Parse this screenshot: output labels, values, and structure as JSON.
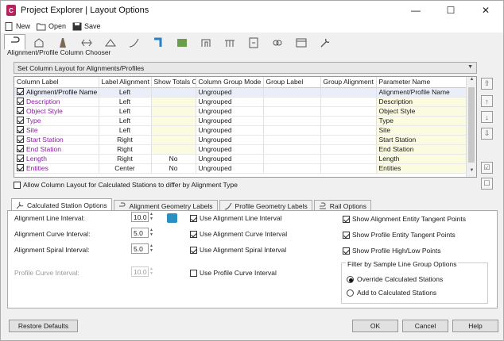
{
  "window": {
    "title": "Project Explorer | Layout Options"
  },
  "menu": {
    "new": "New",
    "open": "Open",
    "save": "Save"
  },
  "chooser": {
    "section_label": "Alignment/Profile Column Chooser",
    "layout_combo": "Set Column Layout for Alignments/Profiles",
    "columns": [
      "Column Label",
      "Label Alignment",
      "Show Totals Cell",
      "Column Group Mode",
      "Group Label",
      "Group Alignment",
      "Parameter Name"
    ],
    "rows": [
      {
        "label": "Alignment/Profile Name",
        "align": "Left",
        "totals": "",
        "mode": "Ungrouped",
        "group_label": "",
        "group_align": "",
        "param": "Alignment/Profile Name"
      },
      {
        "label": "Description",
        "align": "Left",
        "totals": "",
        "mode": "Ungrouped",
        "group_label": "",
        "group_align": "",
        "param": "Description"
      },
      {
        "label": "Object Style",
        "align": "Left",
        "totals": "",
        "mode": "Ungrouped",
        "group_label": "",
        "group_align": "",
        "param": "Object Style"
      },
      {
        "label": "Type",
        "align": "Left",
        "totals": "",
        "mode": "Ungrouped",
        "group_label": "",
        "group_align": "",
        "param": "Type"
      },
      {
        "label": "Site",
        "align": "Left",
        "totals": "",
        "mode": "Ungrouped",
        "group_label": "",
        "group_align": "",
        "param": "Site"
      },
      {
        "label": "Start Station",
        "align": "Right",
        "totals": "",
        "mode": "Ungrouped",
        "group_label": "",
        "group_align": "",
        "param": "Start Station"
      },
      {
        "label": "End Station",
        "align": "Right",
        "totals": "",
        "mode": "Ungrouped",
        "group_label": "",
        "group_align": "",
        "param": "End Station"
      },
      {
        "label": "Length",
        "align": "Right",
        "totals": "No",
        "mode": "Ungrouped",
        "group_label": "",
        "group_align": "",
        "param": "Length"
      },
      {
        "label": "Entities",
        "align": "Center",
        "totals": "No",
        "mode": "Ungrouped",
        "group_label": "",
        "group_align": "",
        "param": "Entities"
      }
    ],
    "allow_label": "Allow Column Layout for Calculated Stations to differ by Alignment Type"
  },
  "tabs": [
    "Calculated Station Options",
    "Alignment Geometry Labels",
    "Profile Geometry Labels",
    "Rail Options"
  ],
  "calc": {
    "align_line_label": "Alignment Line Interval:",
    "align_line_value": "10.0",
    "align_curve_label": "Alignment Curve Interval:",
    "align_curve_value": "5.0",
    "align_spiral_label": "Alignment Spiral Interval:",
    "align_spiral_value": "5.0",
    "profile_curve_label": "Profile Curve Interval:",
    "profile_curve_value": "10.0",
    "use_line": "Use Alignment Line Interval",
    "use_curve": "Use Alignment Curve Interval",
    "use_spiral": "Use Alignment Spiral Interval",
    "use_profile": "Use Profile Curve Interval",
    "show_tangent": "Show Alignment Entity Tangent Points",
    "show_profile_tangent": "Show Profile Entity Tangent Points",
    "show_highlow": "Show Profile High/Low Points",
    "filter_title": "Filter by Sample Line Group Options",
    "override": "Override Calculated Stations",
    "add": "Add to Calculated Stations"
  },
  "footer": {
    "restore": "Restore Defaults",
    "ok": "OK",
    "cancel": "Cancel",
    "help": "Help"
  }
}
